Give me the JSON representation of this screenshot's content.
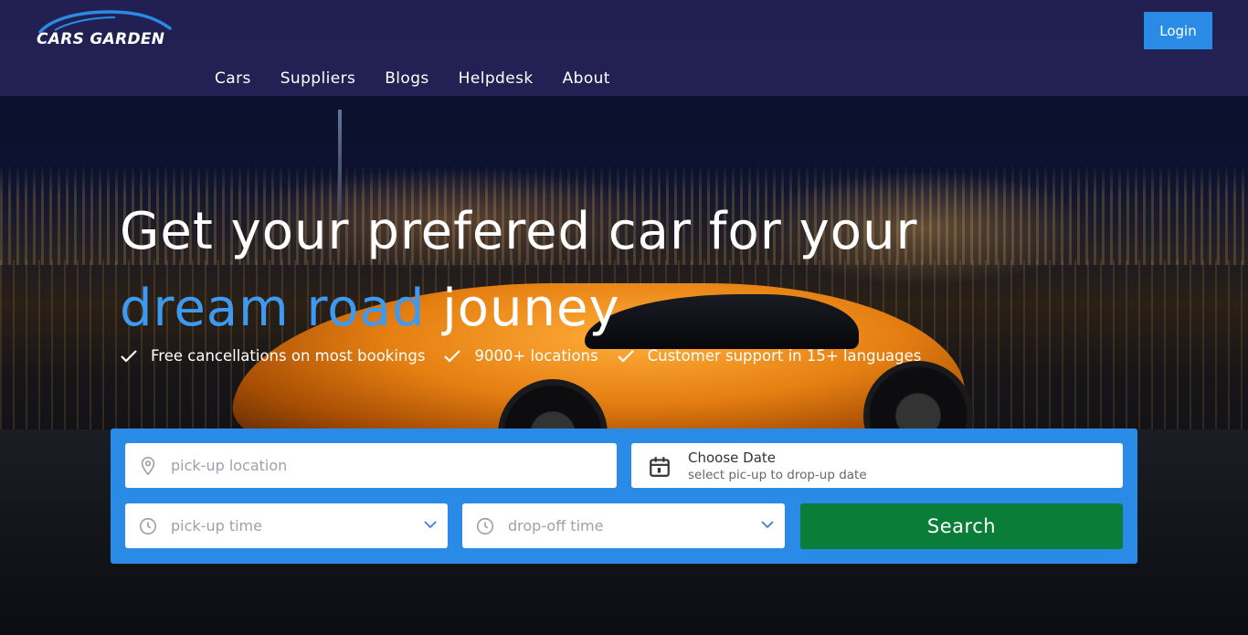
{
  "brand": {
    "logo_text": "CARS GARDEN"
  },
  "nav": {
    "items": [
      "Cars",
      "Suppliers",
      "Blogs",
      "Helpdesk",
      "About"
    ]
  },
  "header": {
    "login_label": "Login"
  },
  "hero": {
    "headline_line1": "Get your prefered car for your",
    "headline_accent": "dream road",
    "headline_rest": " jouney",
    "features": [
      "Free cancellations on most bookings",
      "9000+ locations",
      "Customer support in 15+ languages"
    ]
  },
  "search": {
    "location_placeholder": "pick-up location",
    "date_title": "Choose Date",
    "date_subtitle": "select pic-up to drop-up date",
    "pickup_time_placeholder": "pick-up time",
    "dropoff_time_placeholder": "drop-off time",
    "search_label": "Search"
  },
  "colors": {
    "accent": "#3d9af0",
    "panel": "#2a8be6",
    "search_button": "#0a7d38",
    "header": "#28245c"
  },
  "icons": [
    "car-logo-icon",
    "check-icon",
    "map-pin-icon",
    "calendar-icon",
    "clock-icon",
    "chevron-down-icon"
  ]
}
